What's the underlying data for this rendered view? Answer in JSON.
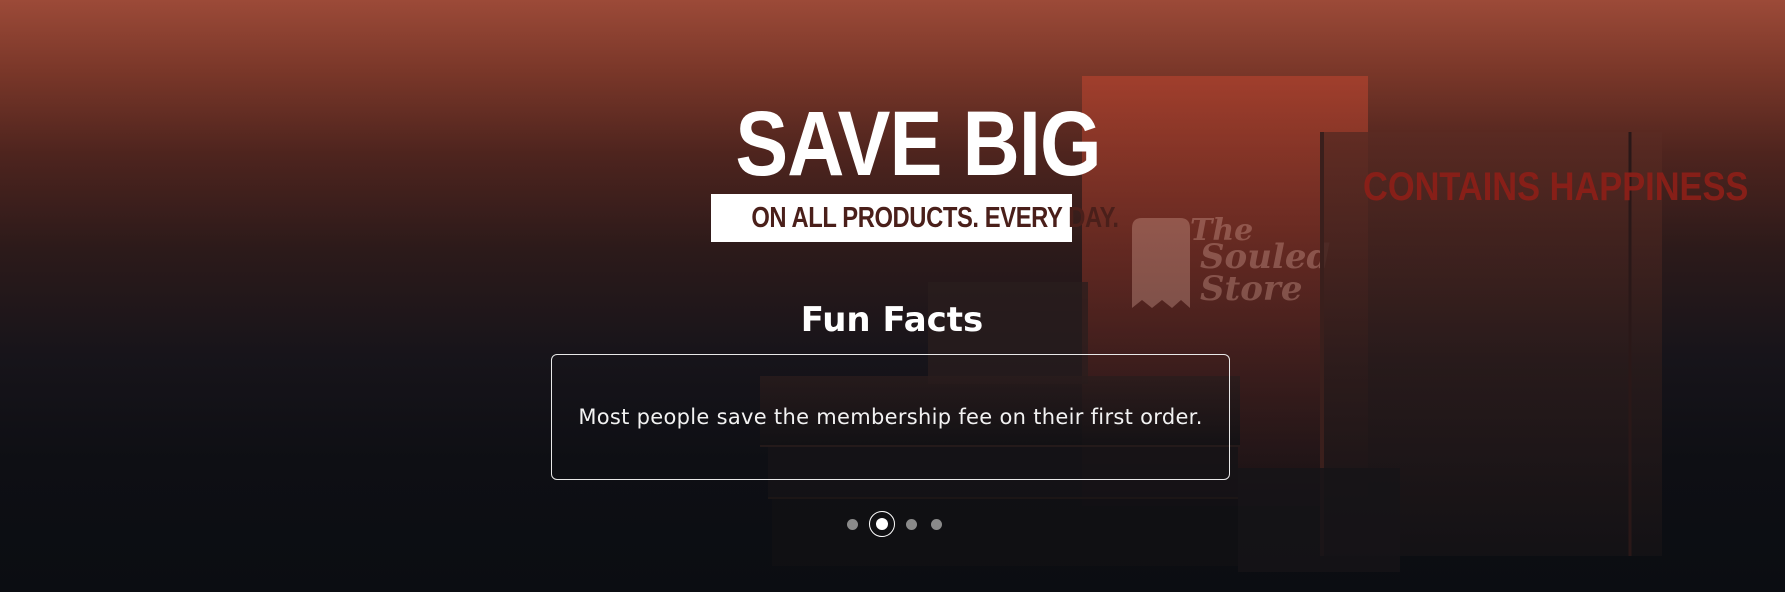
{
  "hero": {
    "headline": "SAVE BIG",
    "subheadline": "ON ALL PRODUCTS. EVERY DAY.",
    "background_box_text": "CONTAINS HAPPINESS",
    "brand_logo_text": [
      "The",
      "Souled",
      "Store"
    ]
  },
  "fun_facts": {
    "title": "Fun Facts",
    "current_fact": "Most people save the membership fee on their first order.",
    "slide_count": 4,
    "active_slide": 2
  },
  "colors": {
    "gradient_top": "#9c4a38",
    "gradient_bottom": "#0b0d12",
    "subheadline_text": "#4a1f1a",
    "box_print_red": "#8e1f18"
  }
}
